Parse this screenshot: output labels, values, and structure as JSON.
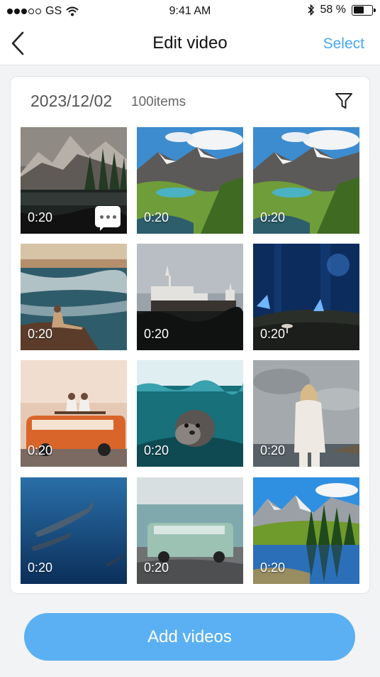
{
  "status_bar": {
    "carrier": "GS",
    "time": "9:41 AM",
    "battery": "58 %",
    "battery_level": 0.58,
    "signal_bars": 3,
    "signal_total": 5
  },
  "nav": {
    "title": "Edit video",
    "select_label": "Select",
    "accent_color": "#4aa8f2"
  },
  "album": {
    "date": "2023/12/02",
    "count": "100items"
  },
  "videos": [
    {
      "duration": "0:20",
      "scene": "mountain-lake-forest",
      "has_more_menu": true
    },
    {
      "duration": "0:20",
      "scene": "alpine-lake-valley"
    },
    {
      "duration": "0:20",
      "scene": "alpine-lake-valley"
    },
    {
      "duration": "0:20",
      "scene": "woman-on-beach-rock"
    },
    {
      "duration": "0:20",
      "scene": "castle"
    },
    {
      "duration": "0:20",
      "scene": "blue-butterfly-forest"
    },
    {
      "duration": "0:20",
      "scene": "couple-on-orange-van"
    },
    {
      "duration": "0:20",
      "scene": "sea-lion-underwater"
    },
    {
      "duration": "0:20",
      "scene": "woman-by-sea"
    },
    {
      "duration": "0:20",
      "scene": "dolphins-underwater"
    },
    {
      "duration": "0:20",
      "scene": "green-van-by-sea"
    },
    {
      "duration": "0:20",
      "scene": "mountain-lake-reflection"
    }
  ],
  "add_button_label": "Add videos"
}
